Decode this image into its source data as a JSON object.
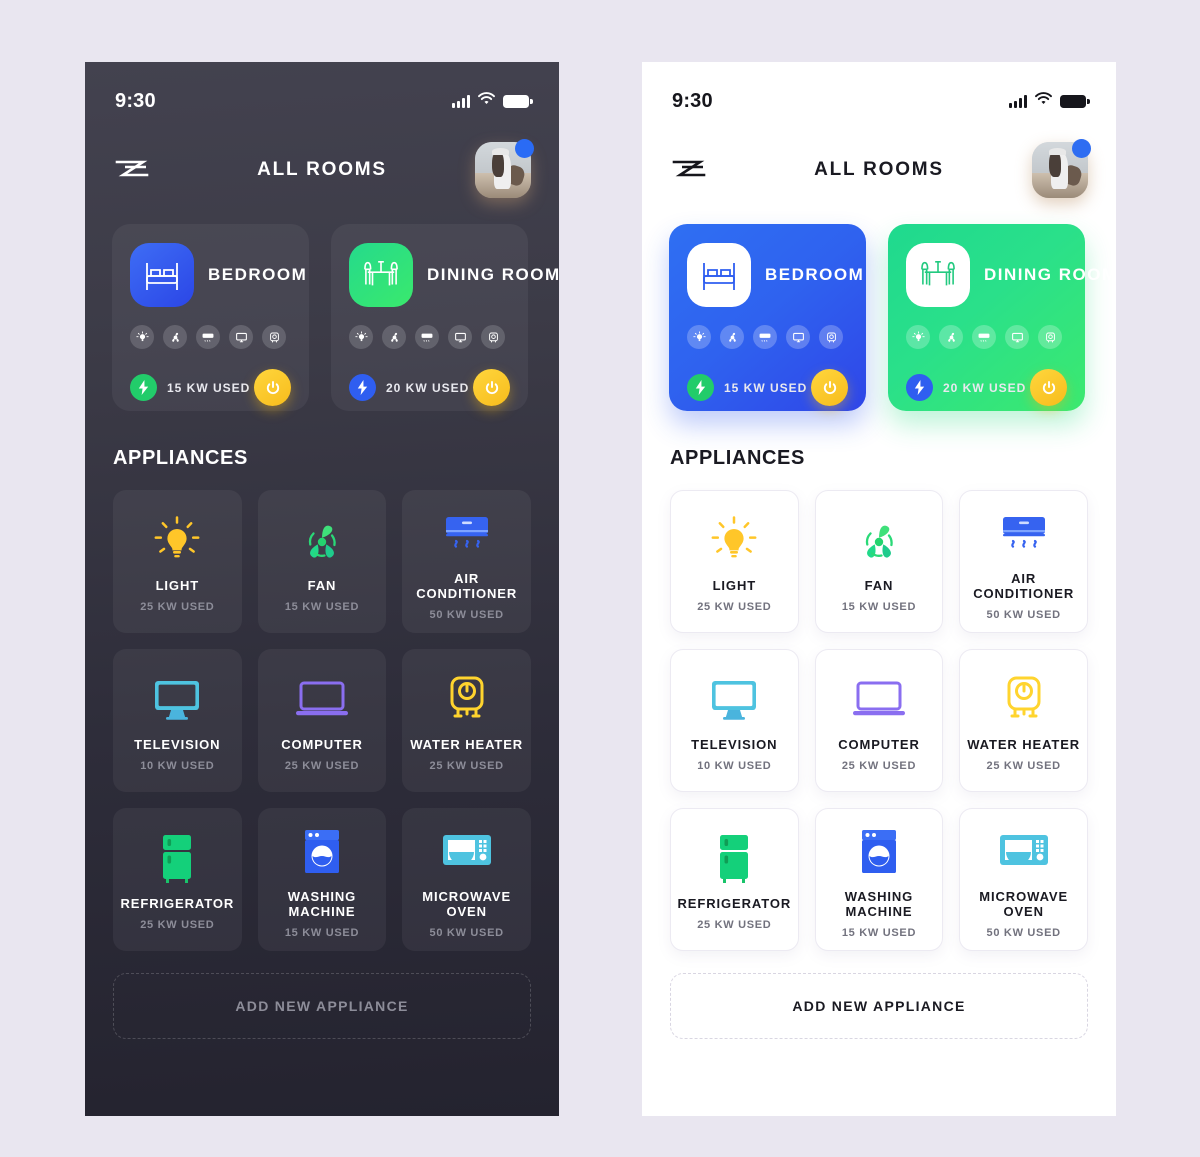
{
  "page": {
    "background": "#e9e6f0"
  },
  "status_bar": {
    "time": "9:30",
    "icons": [
      "signal-bars-icon",
      "wifi-icon",
      "battery-icon"
    ]
  },
  "header": {
    "menu_logo": "zz-logo-icon",
    "title": "ALL ROOMS",
    "avatar": "user-avatar",
    "badge": "notification-dot"
  },
  "rooms": [
    {
      "name": "BEDROOM",
      "icon": "bed-icon",
      "accent": "#2f5ef0",
      "usage": "15 KW USED",
      "bolt_color": "#22cc6a",
      "devices": [
        "light-icon",
        "fan-icon",
        "air-conditioner-icon",
        "television-icon",
        "water-heater-icon"
      ],
      "power_button": "power-icon"
    },
    {
      "name": "DINING ROOM",
      "icon": "dining-table-icon",
      "accent": "#2ae08a",
      "usage": "20 KW USED",
      "bolt_color": "#2f5ef0",
      "devices": [
        "light-icon",
        "fan-icon",
        "air-conditioner-icon",
        "television-icon",
        "water-heater-icon"
      ],
      "power_button": "power-icon"
    }
  ],
  "appliances_section": {
    "title": "APPLIANCES",
    "items": [
      {
        "name": "LIGHT",
        "usage": "25 KW USED",
        "icon": "light-bulb-icon",
        "color": "#ffc629"
      },
      {
        "name": "FAN",
        "usage": "15 KW USED",
        "icon": "fan-icon",
        "color": "#24d46f"
      },
      {
        "name": "AIR CONDITIONER",
        "usage": "50 KW USED",
        "icon": "air-conditioner-icon",
        "color": "#3663f0"
      },
      {
        "name": "TELEVISION",
        "usage": "10 KW USED",
        "icon": "television-icon",
        "color": "#4ec3e0"
      },
      {
        "name": "COMPUTER",
        "usage": "25 KW USED",
        "icon": "computer-icon",
        "color": "#a566e8"
      },
      {
        "name": "WATER HEATER",
        "usage": "25 KW USED",
        "icon": "water-heater-icon",
        "color": "#ffd42e"
      },
      {
        "name": "REFRIGERATOR",
        "usage": "25 KW USED",
        "icon": "refrigerator-icon",
        "color": "#27d96e"
      },
      {
        "name": "WASHING MACHINE",
        "usage": "15 KW USED",
        "icon": "washing-machine-icon",
        "color": "#2f5ef0"
      },
      {
        "name": "MICROWAVE OVEN",
        "usage": "50 KW USED",
        "icon": "microwave-icon",
        "color": "#4ec3e0"
      }
    ],
    "add_button": "ADD NEW APPLIANCE"
  }
}
